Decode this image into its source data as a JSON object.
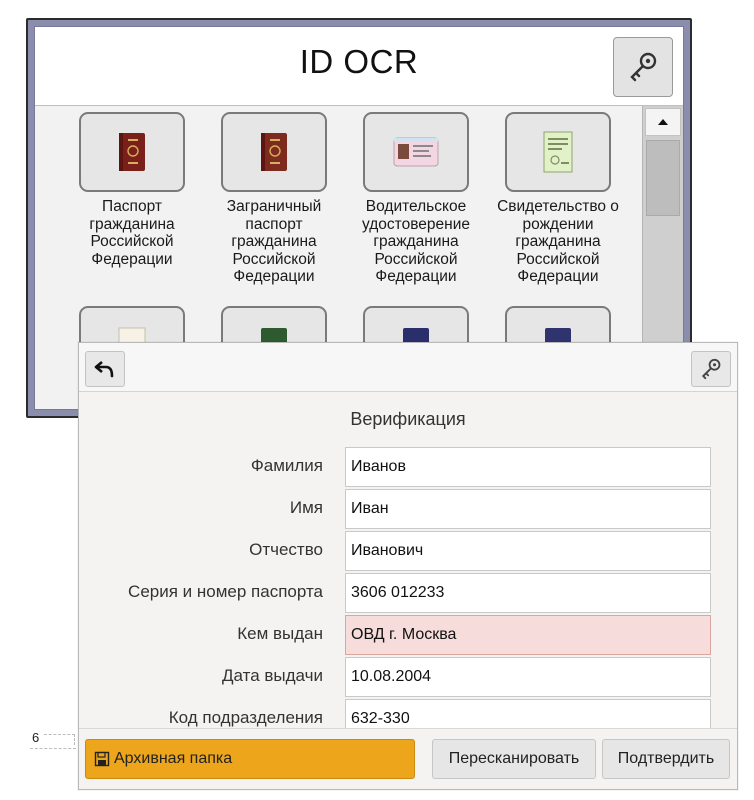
{
  "back_window": {
    "title": "ID OCR",
    "documents": [
      {
        "label": "Паспорт гражданина Российской Федерации",
        "icon": "passport-red-icon"
      },
      {
        "label": "Заграничный паспорт гражданина Российской Федерации",
        "icon": "passport-red-icon"
      },
      {
        "label": "Водительское удостоверение гражданина Российской Федерации",
        "icon": "driver-license-icon"
      },
      {
        "label": "Свидетельство о рождении гражданина Российской Федерации",
        "icon": "certificate-icon"
      }
    ],
    "second_row_icons": [
      "document-white-icon",
      "passport-green-icon",
      "passport-blue-icon",
      "passport-blue-icon"
    ]
  },
  "front_window": {
    "section_title": "Верификация",
    "fields": [
      {
        "label": "Фамилия",
        "value": "Иванов"
      },
      {
        "label": "Имя",
        "value": "Иван"
      },
      {
        "label": "Отчество",
        "value": "Иванович"
      },
      {
        "label": "Серия и номер паспорта",
        "value": "3606 012233"
      },
      {
        "label": "Кем выдан",
        "value": "ОВД г. Москва",
        "status": "error"
      },
      {
        "label": "Дата выдачи",
        "value": "10.08.2004"
      },
      {
        "label": "Код подразделения",
        "value": "632-330"
      }
    ],
    "buttons": {
      "archive": "Архивная папка",
      "rescan": "Пересканировать",
      "confirm": "Подтвердить"
    }
  },
  "pager": {
    "page": "6"
  },
  "colors": {
    "archive_button": "#eda51c",
    "error_field": "#f6dcda",
    "window_frame": "#8b8dac"
  }
}
